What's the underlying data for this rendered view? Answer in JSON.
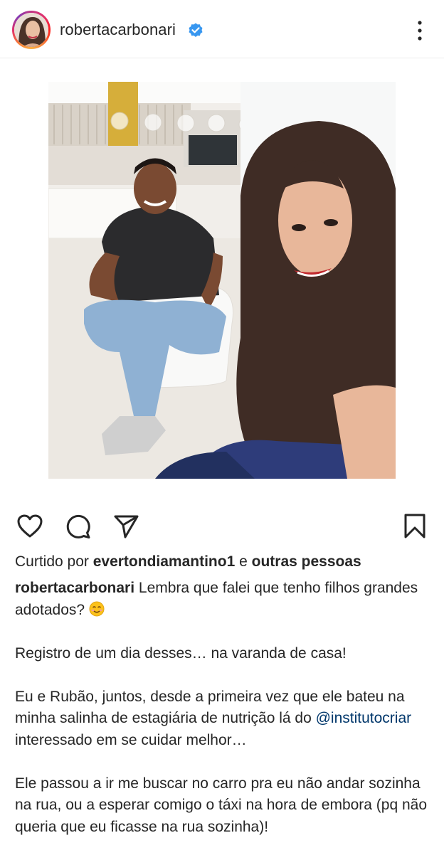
{
  "header": {
    "username": "robertacarbonari",
    "avatar_icon": "profile-avatar",
    "verified_icon": "verified-badge-icon",
    "more_icon": "more-vertical-icon"
  },
  "post": {
    "image_description_icon": "post-photo"
  },
  "actions": {
    "like_icon": "heart-icon",
    "comment_icon": "comment-icon",
    "share_icon": "send-icon",
    "save_icon": "bookmark-icon"
  },
  "likes": {
    "prefix": "Curtido por ",
    "user": "evertondiamantino1",
    "middle": " e ",
    "others": "outras pessoas"
  },
  "caption": {
    "username": "robertacarbonari",
    "line1": " Lembra que falei que tenho filhos grandes adotados? ",
    "paragraph2": "Registro de um dia desses… na varanda de casa!",
    "paragraph3_a": "Eu e Rubão, juntos, desde a primeira vez que ele bateu na minha salinha de estagiária de nutrição lá do ",
    "mention": "@institutocriar",
    "paragraph3_b": " interessado em se cuidar melhor…",
    "paragraph4": "Ele passou a ir me buscar no carro pra eu não andar sozinha na rua, ou a esperar comigo o táxi na hora de embora (pq não queria que eu ficasse na rua sozinha)!"
  },
  "colors": {
    "text": "#262626",
    "verified": "#3897f0",
    "mention": "#00376b",
    "border": "#ececec"
  }
}
